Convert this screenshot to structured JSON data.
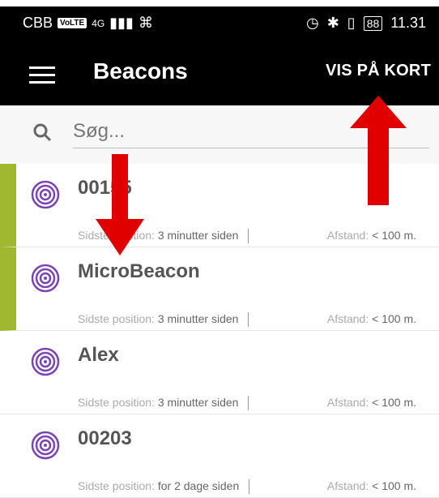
{
  "statusbar": {
    "carrier": "CBB",
    "volte": "VoLTE",
    "network": "4G",
    "battery": "88",
    "time": "11.31"
  },
  "appbar": {
    "title": "Beacons",
    "map_button": "VIS PÅ KORT"
  },
  "search": {
    "placeholder": "Søg..."
  },
  "beacons": [
    {
      "name": "00155",
      "position_label": "Sidste position:",
      "position_value": "3 minutter siden",
      "distance_label": "Afstand:",
      "distance_value": "< 100 m.",
      "active": true
    },
    {
      "name": "MicroBeacon",
      "position_label": "Sidste position:",
      "position_value": "3 minutter siden",
      "distance_label": "Afstand:",
      "distance_value": "< 100 m.",
      "active": true
    },
    {
      "name": "Alex",
      "position_label": "Sidste position:",
      "position_value": "3 minutter siden",
      "distance_label": "Afstand:",
      "distance_value": "< 100 m.",
      "active": false
    },
    {
      "name": "00203",
      "position_label": "Sidste position:",
      "position_value": "for 2 dage siden",
      "distance_label": "Afstand:",
      "distance_value": "< 100 m.",
      "active": false
    }
  ],
  "colors": {
    "accent": "#9fb830",
    "icon": "#7a43b6",
    "annotation_arrow": "#e00000"
  },
  "icons": {
    "menu": "hamburger-menu-icon",
    "search": "search-icon",
    "beacon": "beacon-icon"
  }
}
